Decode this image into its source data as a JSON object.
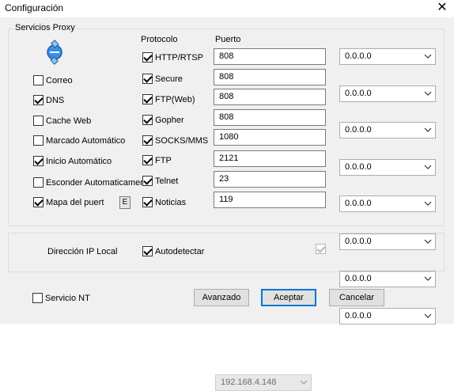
{
  "window": {
    "title": "Configuración",
    "close_icon": "close-icon"
  },
  "group": {
    "label": "Servicios Proxy"
  },
  "headers": {
    "protocol": "Protocolo",
    "port": "Puerto"
  },
  "left_options": [
    {
      "label": "Correo",
      "checked": false
    },
    {
      "label": "DNS",
      "checked": true
    },
    {
      "label": "Cache Web",
      "checked": false
    },
    {
      "label": "Marcado Automático",
      "checked": false
    },
    {
      "label": "Inicio Automático",
      "checked": true
    },
    {
      "label": "Esconder Automaticamer",
      "checked": false
    },
    {
      "label": "Mapa del puert",
      "checked": true,
      "extra_button": "E"
    }
  ],
  "protocols": [
    {
      "label": "HTTP/RTSP",
      "checked": true,
      "port": "808",
      "ip": "0.0.0.0"
    },
    {
      "label": "Secure",
      "checked": true,
      "port": "808",
      "ip": "0.0.0.0"
    },
    {
      "label": "FTP(Web)",
      "checked": true,
      "port": "808",
      "ip": "0.0.0.0"
    },
    {
      "label": "Gopher",
      "checked": true,
      "port": "808",
      "ip": "0.0.0.0"
    },
    {
      "label": "SOCKS/MMS",
      "checked": true,
      "port": "1080",
      "ip": "0.0.0.0"
    },
    {
      "label": "FTP",
      "checked": true,
      "port": "2121",
      "ip": "0.0.0.0"
    },
    {
      "label": "Telnet",
      "checked": true,
      "port": "23",
      "ip": "0.0.0.0"
    },
    {
      "label": "Noticias",
      "checked": true,
      "port": "119",
      "ip": "0.0.0.0"
    }
  ],
  "local_ip": {
    "label": "Dirección IP Local",
    "autodetect_label": "Autodetectar",
    "autodetect_checked": true,
    "ip_value": "192.168.4.148",
    "extra_checked": true
  },
  "footer": {
    "service_nt_label": "Servicio NT",
    "service_nt_checked": false,
    "advanced_label": "Avanzado",
    "accept_label": "Aceptar",
    "cancel_label": "Cancelar"
  },
  "colors": {
    "accent": "#0078d7",
    "background": "#f0f0f0"
  }
}
